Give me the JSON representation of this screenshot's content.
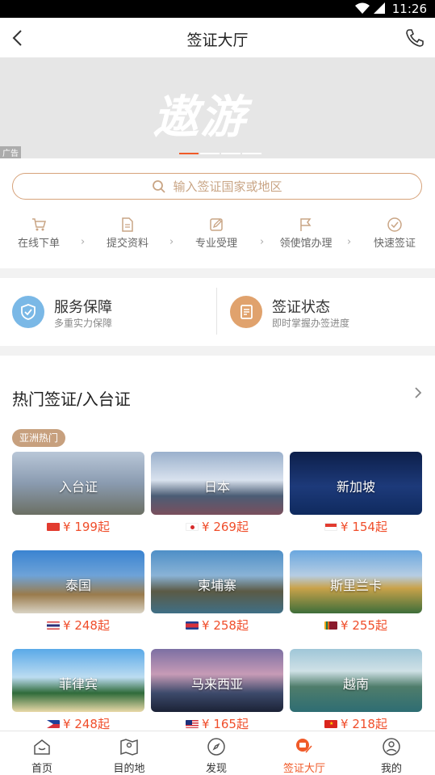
{
  "status": {
    "time": "11:26"
  },
  "navbar": {
    "title": "签证大厅"
  },
  "banner": {
    "logo_text": "遨游",
    "ad_label": "广告"
  },
  "search": {
    "placeholder": "输入签证国家或地区"
  },
  "steps": [
    {
      "label": "在线下单",
      "icon": "cart-icon"
    },
    {
      "label": "提交资料",
      "icon": "document-icon"
    },
    {
      "label": "专业受理",
      "icon": "edit-icon"
    },
    {
      "label": "领使馆办理",
      "icon": "flag-icon"
    },
    {
      "label": "快速签证",
      "icon": "check-circle-icon"
    }
  ],
  "services": [
    {
      "title": "服务保障",
      "subtitle": "多重实力保障",
      "icon": "shield-icon",
      "color": "#7ab8e6"
    },
    {
      "title": "签证状态",
      "subtitle": "即时掌握办签进度",
      "icon": "doc-status-icon",
      "color": "#e0a26d"
    }
  ],
  "hot": {
    "heading": "热门签证/入台证",
    "tag": "亚洲热门",
    "cards": [
      {
        "name": "入台证",
        "price": "¥ 199起",
        "flag": "tw-permit",
        "bg": "linear-gradient(180deg,#b9c7d8 0%,#8a9bb0 50%,#6b6f63 100%)"
      },
      {
        "name": "日本",
        "price": "¥ 269起",
        "flag": "jp",
        "bg": "linear-gradient(180deg,#9ab0cc 0%,#d9e2ee 45%,#4b5d75 70%,#7a4f5d 100%)"
      },
      {
        "name": "新加坡",
        "price": "¥ 154起",
        "flag": "sg",
        "bg": "linear-gradient(180deg,#0d1f4a 0%,#1d3a7a 55%,#0f2a5e 100%)"
      },
      {
        "name": "泰国",
        "price": "¥ 248起",
        "flag": "th",
        "bg": "linear-gradient(180deg,#3a83d1 0%,#6ea3d8 40%,#9a7b4c 70%,#d9d3c4 100%)"
      },
      {
        "name": "柬埔寨",
        "price": "¥ 258起",
        "flag": "kh",
        "bg": "linear-gradient(180deg,#4e8fc7 0%,#8ab3d6 40%,#5b5a45 65%,#3f6f86 100%)"
      },
      {
        "name": "斯里兰卡",
        "price": "¥ 255起",
        "flag": "lk",
        "bg": "linear-gradient(180deg,#6aa7df 0%,#b6cde3 40%,#c9a24a 60%,#3e6e3a 100%)"
      },
      {
        "name": "菲律宾",
        "price": "¥ 248起",
        "flag": "ph",
        "bg": "linear-gradient(180deg,#5aa9e8 0%,#bcdcf1 45%,#2f6b3a 70%,#e9d9a8 100%)"
      },
      {
        "name": "马来西亚",
        "price": "¥ 165起",
        "flag": "my",
        "bg": "linear-gradient(180deg,#7c6fa3 0%,#c79bb6 40%,#3d4a6b 70%,#1b2236 100%)"
      },
      {
        "name": "越南",
        "price": "¥ 218起",
        "flag": "vn",
        "bg": "linear-gradient(180deg,#9fc6d8 0%,#cfe1e6 35%,#4f7d6b 60%,#2e6d73 100%)"
      }
    ]
  },
  "tabbar": [
    {
      "label": "首页",
      "icon": "home-icon",
      "active": false
    },
    {
      "label": "目的地",
      "icon": "map-icon",
      "active": false
    },
    {
      "label": "发现",
      "icon": "compass-icon",
      "active": false
    },
    {
      "label": "签证大厅",
      "icon": "visa-icon",
      "active": true
    },
    {
      "label": "我的",
      "icon": "profile-icon",
      "active": false
    }
  ],
  "colors": {
    "accent": "#f05a28",
    "price": "#f04e2b",
    "tag": "#c7a07e",
    "search_border": "#d6a27a"
  }
}
